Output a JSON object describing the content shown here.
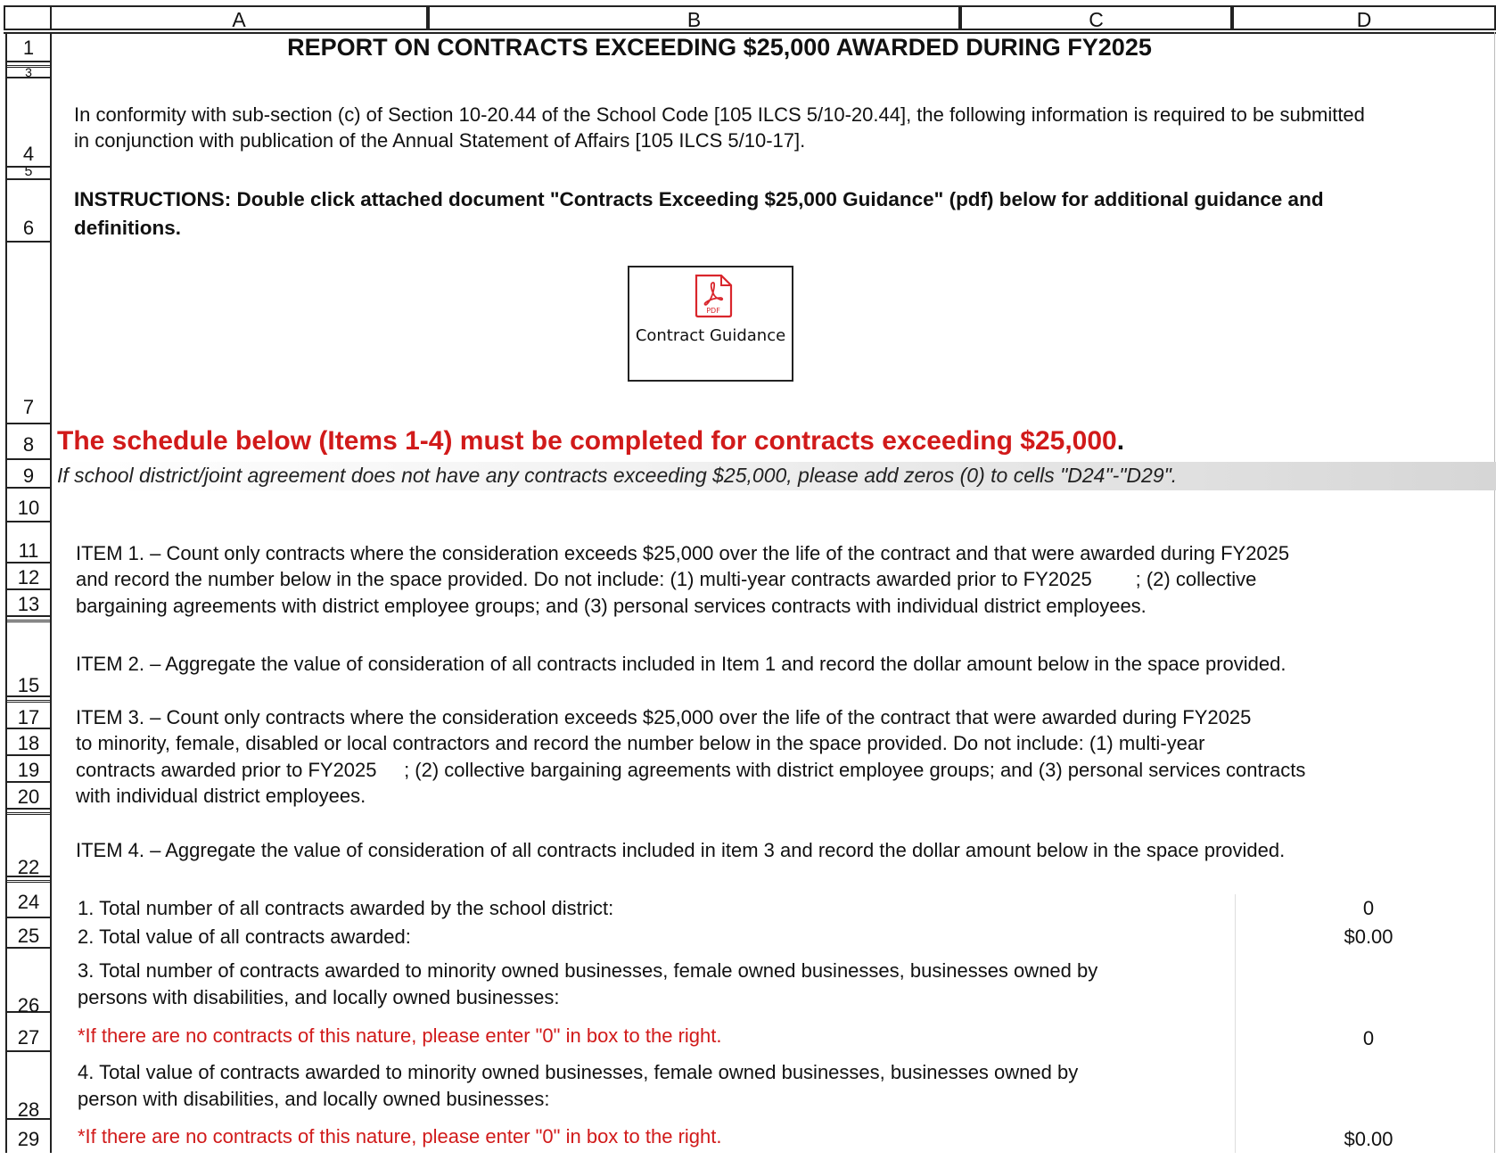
{
  "columns": [
    "A",
    "B",
    "C",
    "D"
  ],
  "row_numbers": {
    "r1": "1",
    "r3": "3",
    "r4": "4",
    "r5": "5",
    "r6": "6",
    "r7": "7",
    "r8": "8",
    "r9": "9",
    "r10": "10",
    "r11": "11",
    "r12": "12",
    "r13": "13",
    "r15": "15",
    "r17": "17",
    "r18": "18",
    "r19": "19",
    "r20": "20",
    "r22": "22",
    "r24": "24",
    "r25": "25",
    "r26": "26",
    "r27": "27",
    "r28": "28",
    "r29": "29"
  },
  "title": "REPORT ON CONTRACTS EXCEEDING $25,000 AWARDED DURING FY2025",
  "intro": {
    "line1": "In conformity with sub-section (c) of Section 10-20.44 of the School Code [105 ILCS 5/10-20.44], the following information is required to be submitted",
    "line2": "in conjunction with publication of the Annual Statement of Affairs [105 ILCS 5/10-17]."
  },
  "instructions": {
    "line1": "INSTRUCTIONS:  Double click attached document \"Contracts Exceeding $25,000 Guidance\" (pdf) below for additional guidance and",
    "line2": "definitions."
  },
  "attachment": {
    "icon": "pdf-icon",
    "icon_text": "PDF",
    "label": "Contract Guidance",
    "accent": "#d9262c"
  },
  "schedule_notice": "The schedule below (Items 1-4) must be completed for contracts exceeding $25,000",
  "schedule_notice_end": ".",
  "zeros_note": "If school district/joint agreement does not have any contracts exceeding $25,000, please add zeros (0) to cells \"D24\"-\"D29\".",
  "items": {
    "item1": [
      "ITEM 1. – Count only contracts where the consideration exceeds $25,000 over the life of the contract and that were awarded during FY2025",
      "and record the number below in the space provided. Do not include: (1) multi-year contracts awarded prior to FY2025        ; (2) collective",
      "bargaining agreements with district employee groups; and (3) personal services contracts with individual district employees."
    ],
    "item2": "ITEM 2. – Aggregate the value of consideration of all contracts included in Item 1 and record the dollar amount below in the space provided.",
    "item3": [
      "ITEM 3. – Count only contracts where the consideration exceeds $25,000 over the life of the contract that were awarded during FY2025",
      "to minority, female, disabled or local contractors and record the number below in the space provided. Do not include: (1) multi-year",
      "contracts awarded prior to FY2025     ; (2) collective bargaining agreements with district employee groups; and (3) personal services contracts",
      "with individual district employees."
    ],
    "item4": "ITEM 4. – Aggregate the value of consideration of all contracts included in item 3 and record the dollar amount below in the space provided."
  },
  "questions": {
    "q1": "1.  Total number of all contracts awarded by the school district:",
    "q2": "2.  Total value of all contracts awarded:",
    "q3_line1": "3.  Total number of contracts awarded to minority owned businesses, female owned businesses, businesses owned by",
    "q3_line2": "persons with disabilities, and locally owned businesses:",
    "q3_note": "*If there are no contracts of this nature, please enter \"0\" in box to the right.",
    "q4_line1": "4.  Total value of contracts awarded to minority owned businesses, female owned businesses, businesses owned by",
    "q4_line2": "person with disabilities, and locally owned businesses:",
    "q4_note": "*If there are no contracts of this nature, please enter \"0\" in box to the right."
  },
  "values": {
    "d24": "0",
    "d25": "$0.00",
    "d27": "0",
    "d29": "$0.00"
  },
  "colors": {
    "red_text": "#d11a1a",
    "grid": "#222222"
  }
}
